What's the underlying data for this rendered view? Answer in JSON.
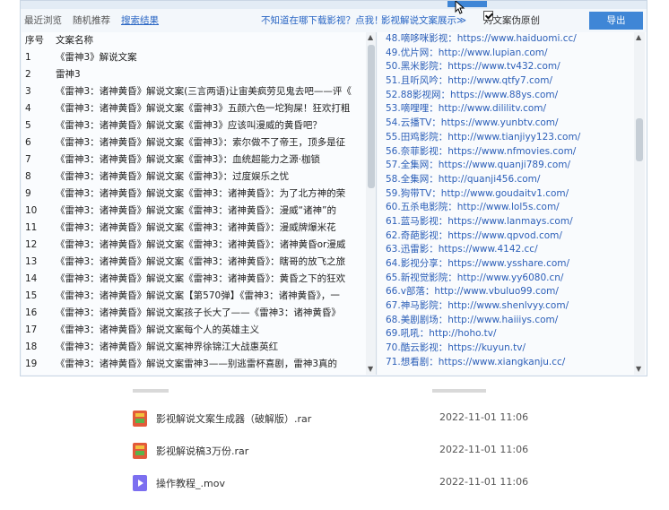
{
  "toolbar": {
    "history": "最近浏览",
    "random": "随机推荐",
    "search_results": "搜索结果",
    "download_hint": "不知道在哪下载影视？点我！",
    "style_display": "影视解说文案展示",
    "style_arrow": "≫",
    "show_source_label": "对文案伪原创",
    "show_source_checked": true,
    "export_button": "导出"
  },
  "table": {
    "headers": {
      "no": "序号",
      "name": "文案名称"
    },
    "rows": [
      {
        "no": "1",
        "name": "《雷神3》解说文案"
      },
      {
        "no": "2",
        "name": "雷神3"
      },
      {
        "no": "3",
        "name": "《雷神3：诸神黄昏》解说文案(三言两语)让宙美疯劳见鬼去吧——评《"
      },
      {
        "no": "4",
        "name": "《雷神3：诸神黄昏》解说文案《雷神3》五颜六色一坨狗屎！狂欢打粗"
      },
      {
        "no": "5",
        "name": "《雷神3：诸神黄昏》解说文案《雷神3》应该叫漫威的黄昏吧？"
      },
      {
        "no": "6",
        "name": "《雷神3：诸神黄昏》解说文案《雷神3》：索尔做不了帝王，顶多是征"
      },
      {
        "no": "7",
        "name": "《雷神3：诸神黄昏》解说文案《雷神3》：血统超能力之源·枷锁"
      },
      {
        "no": "8",
        "name": "《雷神3：诸神黄昏》解说文案《雷神3》：过度娱乐之忧"
      },
      {
        "no": "9",
        "name": "《雷神3：诸神黄昏》解说文案《雷神3：诸神黄昏》：为了北方神的荣"
      },
      {
        "no": "10",
        "name": "《雷神3：诸神黄昏》解说文案《雷神3：诸神黄昏》：漫威“诸神”的"
      },
      {
        "no": "11",
        "name": "《雷神3：诸神黄昏》解说文案《雷神3：诸神黄昏》：漫威牌爆米花"
      },
      {
        "no": "12",
        "name": "《雷神3：诸神黄昏》解说文案《雷神3：诸神黄昏》：诸神黄昏or漫威"
      },
      {
        "no": "13",
        "name": "《雷神3：诸神黄昏》解说文案《雷神3：诸神黄昏》：瞎哥的放飞之旅"
      },
      {
        "no": "14",
        "name": "《雷神3：诸神黄昏》解说文案《雷神3：诸神黄昏》：黄昏之下的狂欢"
      },
      {
        "no": "15",
        "name": "《雷神3：诸神黄昏》解说文案【第570弹】《雷神3：诸神黄昏》，一"
      },
      {
        "no": "16",
        "name": "《雷神3：诸神黄昏》解说文案孩子长大了——《雷神3：诸神黄昏》"
      },
      {
        "no": "17",
        "name": "《雷神3：诸神黄昏》解说文案每个人的英雄主义"
      },
      {
        "no": "18",
        "name": "《雷神3：诸神黄昏》解说文案神界徐锦江大战惠英红"
      },
      {
        "no": "19",
        "name": "《雷神3：诸神黄昏》解说文案雷神3——别逃雷杯喜剧，雷神3真的"
      }
    ]
  },
  "sites": [
    "48.嘀哆咪影视：https://www.haiduomi.cc/",
    "49.优片网：http://www.lupian.com/",
    "50.黑米影院：https://www.tv432.com/",
    "51.且听风吟：http://www.qtfy7.com/",
    "52.88影视网：https://www.88ys.com/",
    "53.嘀哩哩：http://www.dililitv.com/",
    "54.云播TV：https://www.yunbtv.com/",
    "55.田鸡影院：http://www.tianjiyy123.com/",
    "56.奈菲影视：https://www.nfmovies.com/",
    "57.全集网：https://www.quanji789.com/",
    "58.全集网：http://quanji456.com/",
    "59.狗带TV：http://www.goudaitv1.com/",
    "60.五杀电影院：http://www.lol5s.com/",
    "61.蓝马影视：https://www.lanmays.com/",
    "62.奇葩影视：https://www.qpvod.com/",
    "63.迅雷影：https://www.4142.cc/",
    "64.影视分享：https://www.ysshare.com/",
    "65.新视觉影院：http://www.yy6080.cn/",
    "66.v部落：http://www.vbuluo99.com/",
    "67.神马影院：http://www.shenlvyy.com/",
    "68.美剧剧场：http://www.haiiiys.com/",
    "69.吼吼：http://hoho.tv/",
    "70.酷云影视：https://kuyun.tv/",
    "71.想看剧：https://www.xiangkanju.cc/"
  ],
  "files": [
    {
      "name": "影视解说文案生成器（破解版）.rar",
      "date": "2022-11-01 11:06",
      "icon": "rar-archive-icon"
    },
    {
      "name": "影视解说稿3万份.rar",
      "date": "2022-11-01 11:06",
      "icon": "rar-archive-icon"
    },
    {
      "name": "操作教程_.mov",
      "date": "2022-11-01 11:06",
      "icon": "video-file-icon"
    }
  ],
  "colors": {
    "accent": "#3f86d6",
    "link": "#2c5fb8",
    "rar": "#e35a3a",
    "mov": "#7c6ff0"
  }
}
